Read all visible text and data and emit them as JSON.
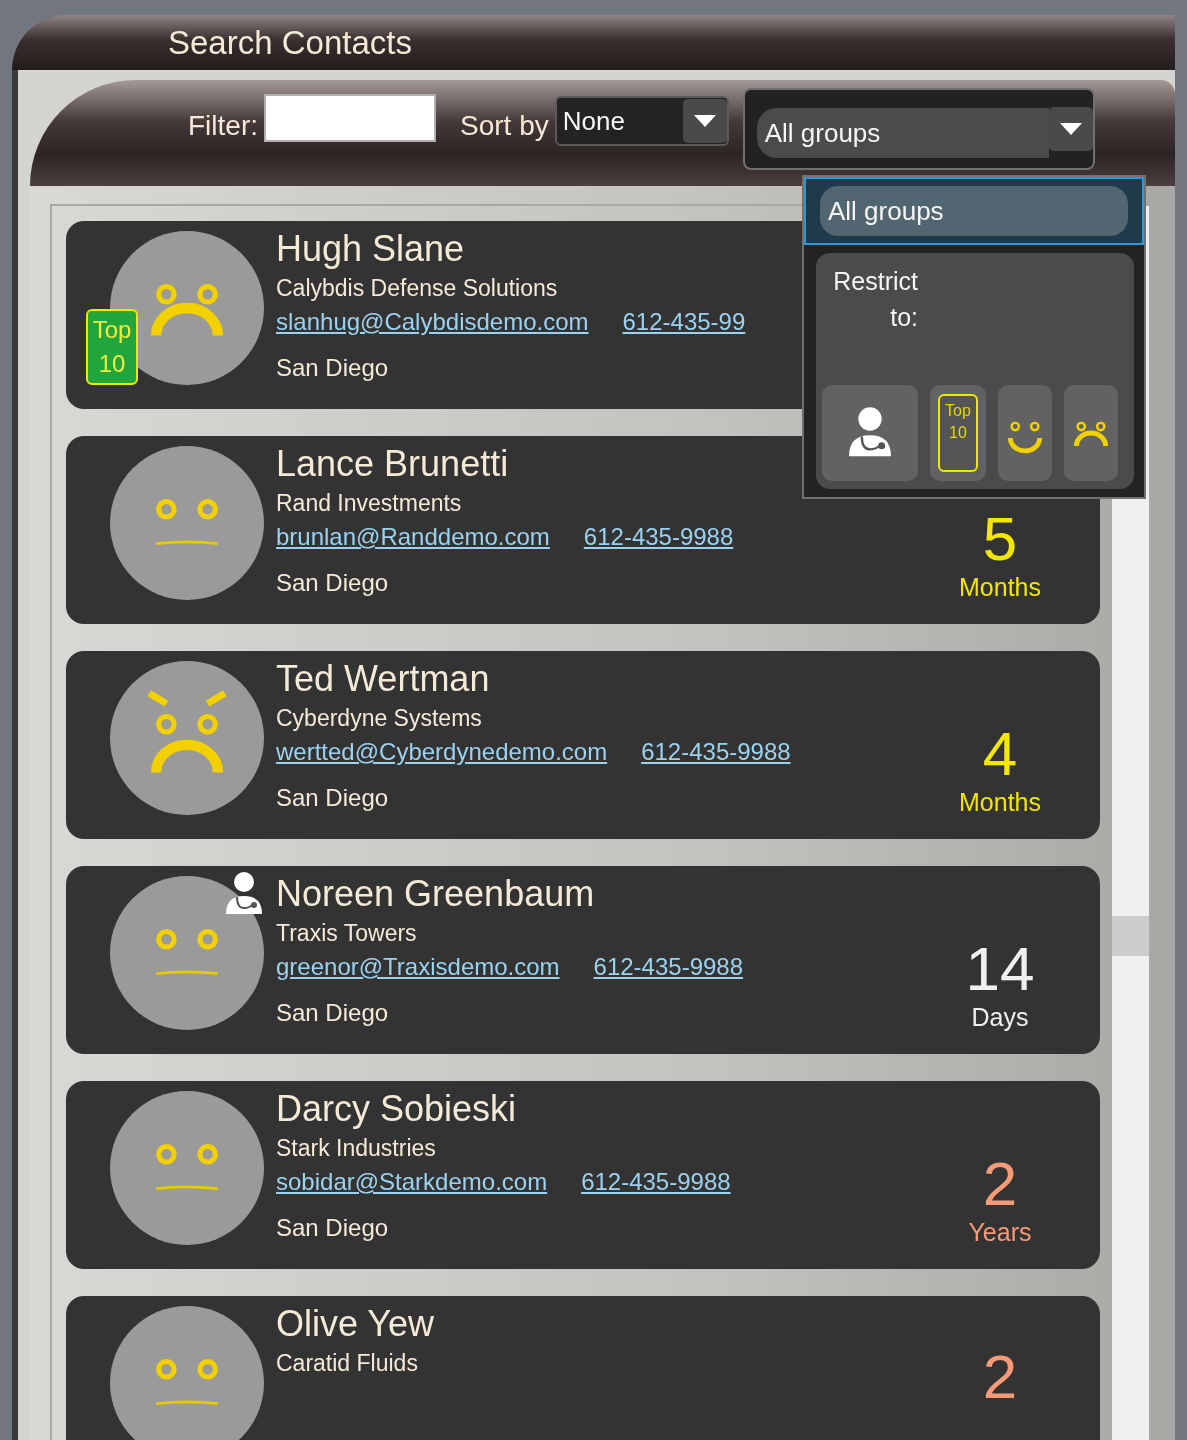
{
  "window": {
    "title": "Search Contacts"
  },
  "toolbar": {
    "filter_label": "Filter:",
    "sort_label": "Sort by",
    "sort": {
      "value": "None"
    },
    "group": {
      "value": "All groups",
      "expanded": true
    }
  },
  "group_dropdown": {
    "items": [
      {
        "label": "All groups",
        "selected": true
      }
    ],
    "restrict_label": "Restrict to:",
    "filters": [
      {
        "kind": "doctor",
        "selected": false
      },
      {
        "kind": "top10",
        "lines": [
          "Top",
          "10"
        ],
        "selected": false
      },
      {
        "kind": "happy",
        "selected": false
      },
      {
        "kind": "sad",
        "selected": false
      }
    ]
  },
  "contacts": [
    {
      "name": "Hugh Slane",
      "company": "Calybdis Defense Solutions",
      "email": "slanhug@Calybdisdemo.com",
      "phone": "612-435-99",
      "city": "San Diego",
      "kind": "sad",
      "badge": {
        "kind": "top10",
        "lines": [
          "Top",
          "10"
        ]
      }
    },
    {
      "name": "Lance Brunetti",
      "company": "Rand Investments",
      "email": "brunlan@Randdemo.com",
      "phone": "612-435-9988",
      "city": "San Diego",
      "kind": "neutral",
      "tenure": {
        "number": "5",
        "unit": "Months",
        "color": "#f3e600"
      }
    },
    {
      "name": "Ted Wertman",
      "company": "Cyberdyne Systems",
      "email": "wertted@Cyberdynedemo.com",
      "phone": "612-435-9988",
      "city": "San Diego",
      "kind": "angry",
      "tenure": {
        "number": "4",
        "unit": "Months",
        "color": "#f3e600"
      }
    },
    {
      "name": "Noreen Greenbaum",
      "company": "Traxis Towers",
      "email": "greenor@Traxisdemo.com",
      "phone": "612-435-9988",
      "city": "San Diego",
      "kind": "neutral",
      "badge": {
        "kind": "doctor"
      },
      "tenure": {
        "number": "14",
        "unit": "Days",
        "color": "#f0f0f0"
      }
    },
    {
      "name": "Darcy Sobieski",
      "company": "Stark Industries",
      "email": "sobidar@Starkdemo.com",
      "phone": "612-435-9988",
      "city": "San Diego",
      "kind": "neutral",
      "tenure": {
        "number": "2",
        "unit": "Years",
        "color": "#f79a78"
      }
    },
    {
      "name": "Olive Yew",
      "company": "Caratid Fluids",
      "kind": "neutral",
      "tenure": {
        "number": "2",
        "color": "#f79a78"
      }
    }
  ]
}
